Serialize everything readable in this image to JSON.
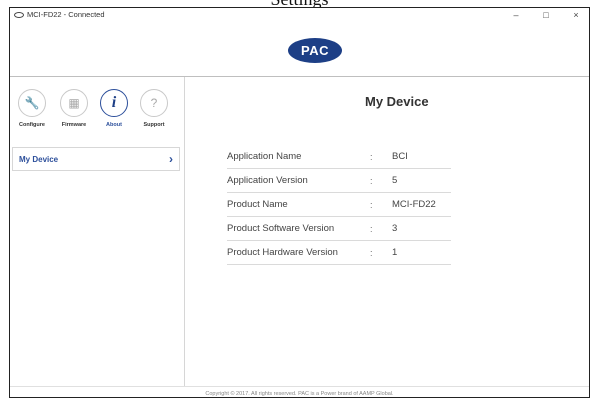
{
  "top_caption": "Settings",
  "window": {
    "title": "MCI-FD22 - Connected",
    "controls": {
      "minimize": "–",
      "maximize": "□",
      "close": "×"
    }
  },
  "logo": {
    "text": "PAC"
  },
  "nav": {
    "items": [
      {
        "id": "configure",
        "label": "Configure",
        "icon": "wrench-icon",
        "glyph": "🔧"
      },
      {
        "id": "firmware",
        "label": "Firmware",
        "icon": "firmware-icon",
        "glyph": "▦"
      },
      {
        "id": "about",
        "label": "About",
        "icon": "info-icon",
        "glyph": "i"
      },
      {
        "id": "support",
        "label": "Support",
        "icon": "question-icon",
        "glyph": "?"
      }
    ],
    "active": "about"
  },
  "sidebar": {
    "items": [
      {
        "label": "My Device",
        "chevron": "›"
      }
    ]
  },
  "main": {
    "title": "My Device",
    "rows": [
      {
        "key": "Application Name",
        "colon": ":",
        "value": "BCI"
      },
      {
        "key": "Application Version",
        "colon": ":",
        "value": "5"
      },
      {
        "key": "Product Name",
        "colon": ":",
        "value": "MCI-FD22"
      },
      {
        "key": "Product Software Version",
        "colon": ":",
        "value": "3"
      },
      {
        "key": "Product Hardware Version",
        "colon": ":",
        "value": "1"
      }
    ]
  },
  "footer": {
    "text": "Copyright © 2017. All rights reserved. PAC is a Power brand of AAMP Global."
  },
  "colors": {
    "accent": "#2c4f9b",
    "logo_bg": "#1d3f86"
  }
}
